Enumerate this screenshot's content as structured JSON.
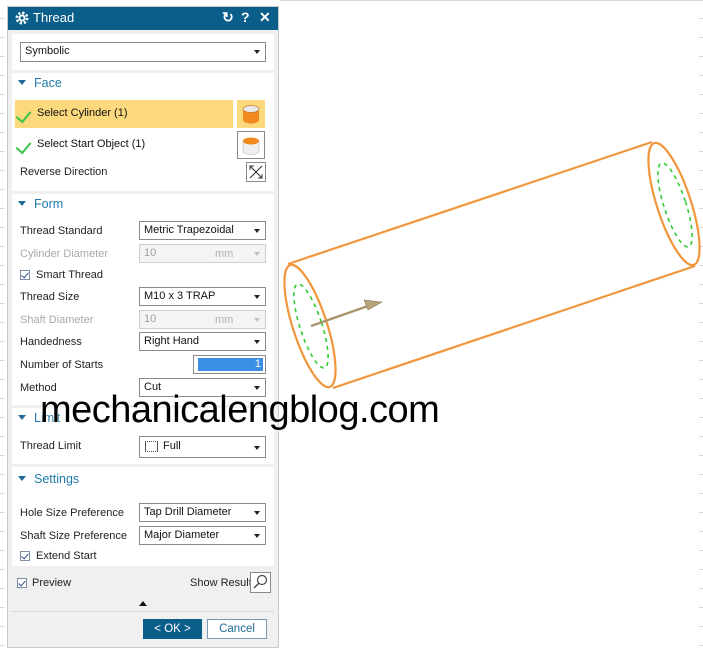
{
  "dialog": {
    "title": "Thread",
    "icons": [
      "gear-icon",
      "reset-icon",
      "help-icon",
      "close-icon"
    ],
    "help_glyph": "?",
    "close_glyph": "✕",
    "reset_glyph": "↻",
    "type_select": {
      "value": "Symbolic"
    }
  },
  "face": {
    "heading": "Face",
    "select_cylinder": {
      "label": "Select Cylinder (1)",
      "active": true
    },
    "select_start_object": {
      "label": "Select Start Object (1)"
    },
    "reverse_direction": {
      "label": "Reverse Direction"
    }
  },
  "form": {
    "heading": "Form",
    "thread_standard": {
      "label": "Thread Standard",
      "value": "Metric Trapezoidal"
    },
    "cylinder_diameter": {
      "label": "Cylinder Diameter",
      "value": "10",
      "unit": "mm",
      "enabled": false
    },
    "smart_thread": {
      "label": "Smart Thread",
      "checked": true
    },
    "thread_size": {
      "label": "Thread Size",
      "value": "M10 x 3 TRAP"
    },
    "shaft_diameter": {
      "label": "Shaft Diameter",
      "value": "10",
      "unit": "mm",
      "enabled": false
    },
    "handedness": {
      "label": "Handedness",
      "value": "Right Hand"
    },
    "number_of_starts": {
      "label": "Number of Starts",
      "value": "1"
    },
    "method": {
      "label": "Method",
      "value": "Cut"
    }
  },
  "limit": {
    "heading": "Limit",
    "thread_limit": {
      "label": "Thread Limit",
      "value": "Full"
    }
  },
  "settings": {
    "heading": "Settings",
    "hole_size_preference": {
      "label": "Hole Size Preference",
      "value": "Tap Drill Diameter"
    },
    "shaft_size_preference": {
      "label": "Shaft Size Preference",
      "value": "Major Diameter"
    },
    "extend_start": {
      "label": "Extend Start",
      "checked": true
    }
  },
  "footer": {
    "preview": {
      "label": "Preview",
      "checked": true
    },
    "show_result": {
      "label": "Show Result"
    },
    "ok_label": "< OK >",
    "cancel_label": "Cancel"
  },
  "watermark": "mechanicalengblog.com",
  "colors": {
    "titlebar": "#0b5d8a",
    "accent_text": "#1f7aa8",
    "active_row": "#fbd97c",
    "cylinder_edge": "#f0963c",
    "thread_symbol": "#33cc33",
    "check_green": "#3ac24a"
  }
}
